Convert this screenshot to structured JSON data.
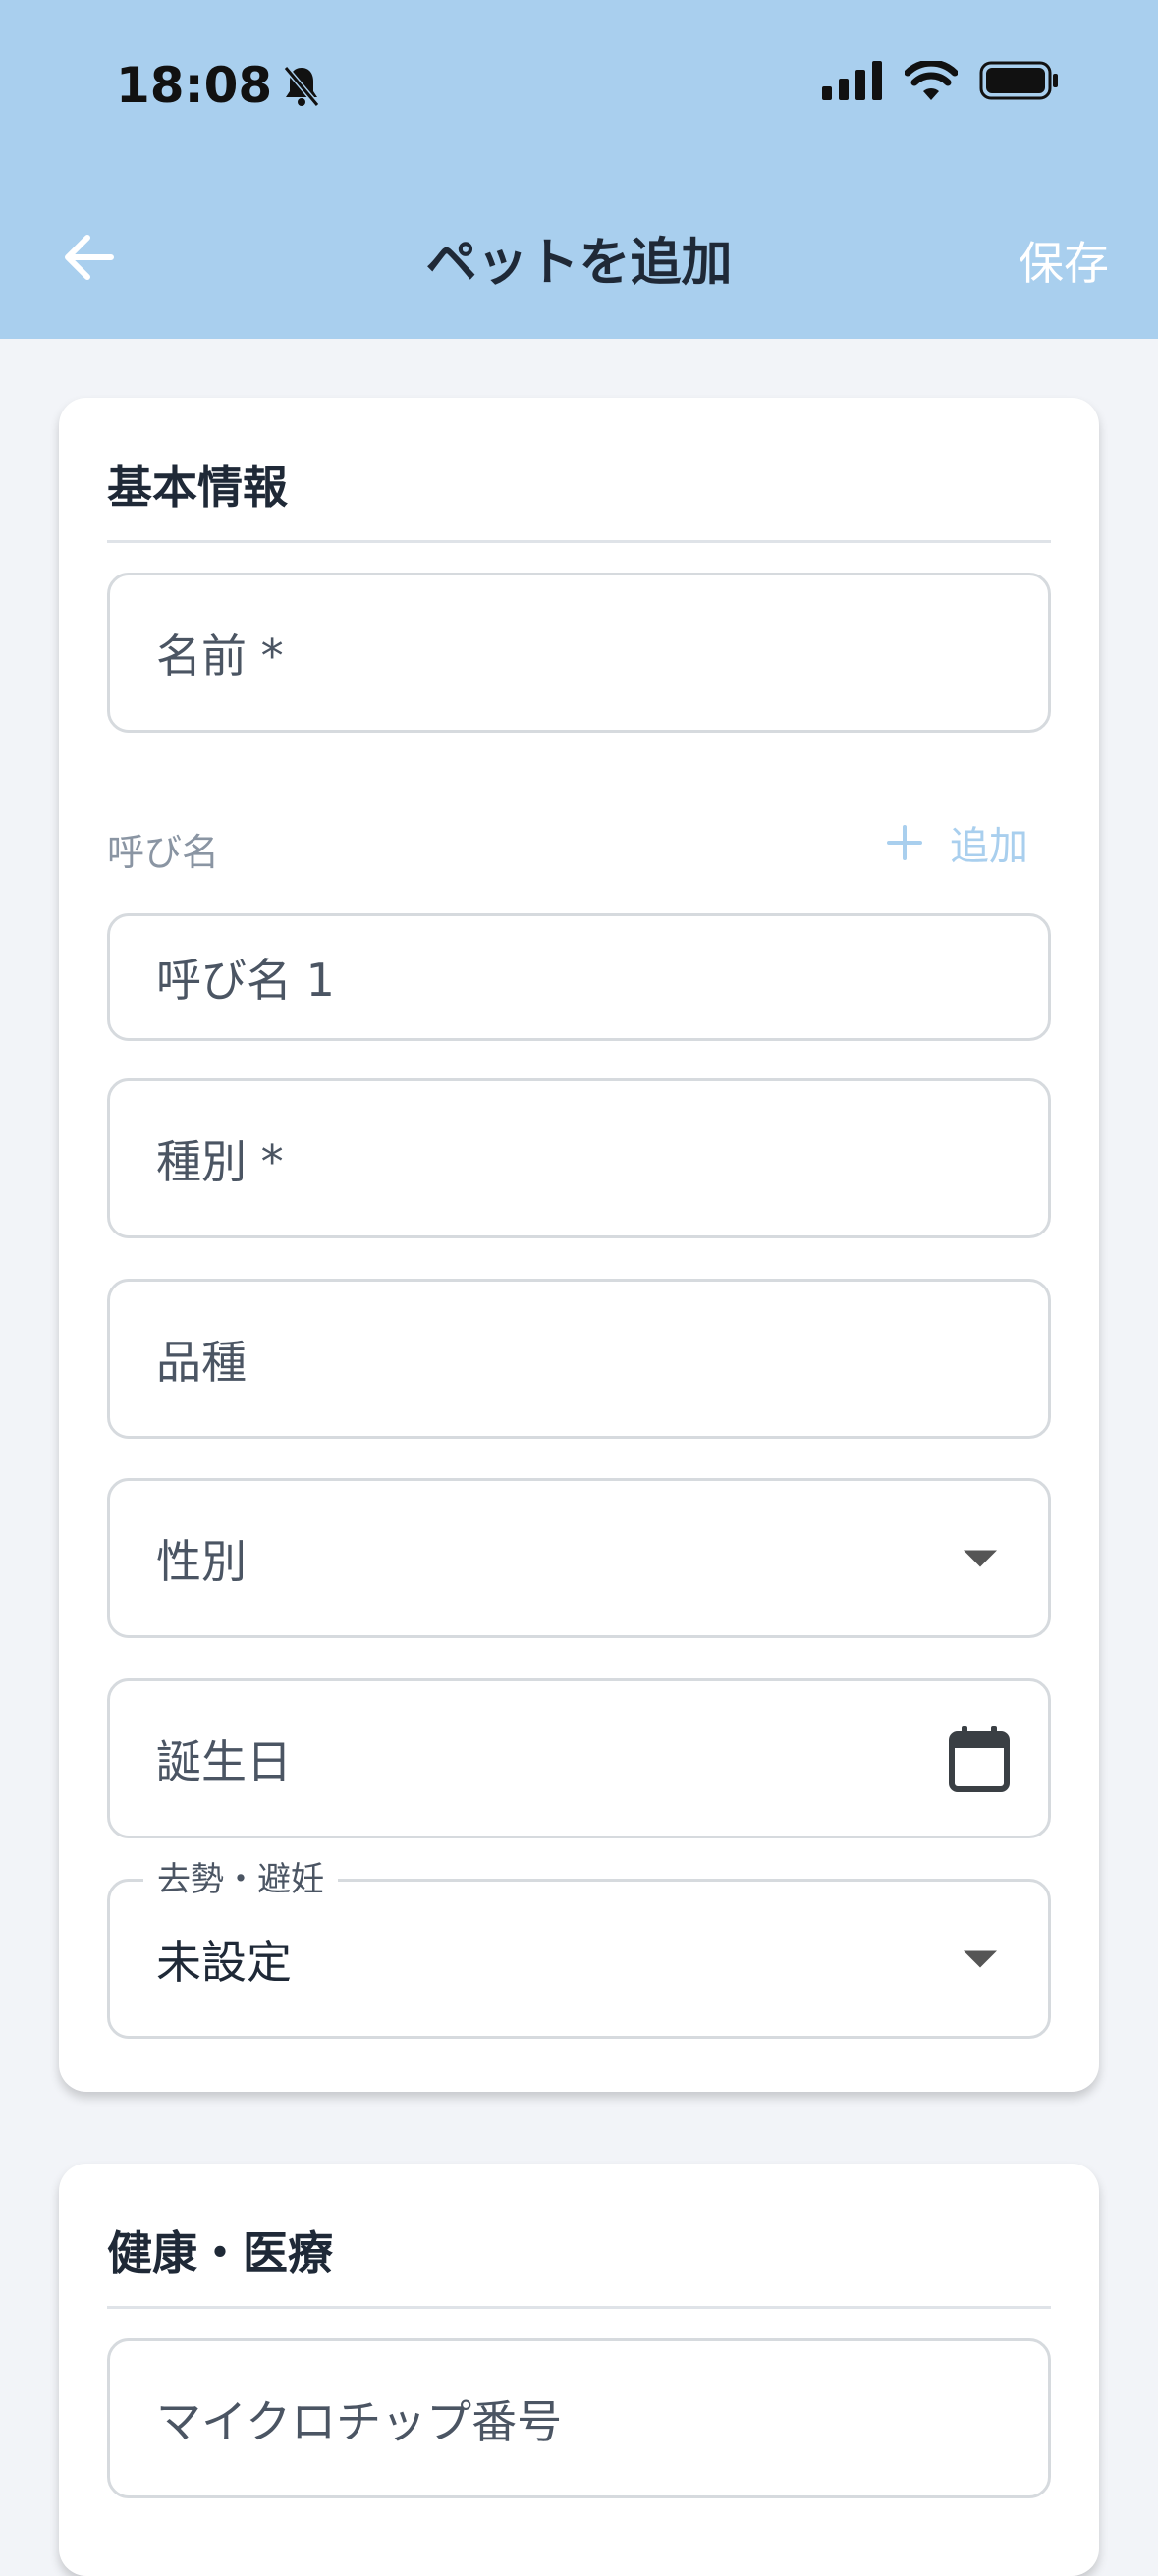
{
  "status_bar": {
    "time": "18:08"
  },
  "header": {
    "title": "ペットを追加",
    "save_label": "保存"
  },
  "basic_info": {
    "title": "基本情報",
    "name_placeholder": "名前 *",
    "nickname_label": "呼び名",
    "nickname_add_label": "追加",
    "nickname_placeholder": "呼び名 1",
    "species_placeholder": "種別 *",
    "breed_placeholder": "品種",
    "sex_placeholder": "性別",
    "birthday_placeholder": "誕生日",
    "neuter_label": "去勢・避妊",
    "neuter_value": "未設定"
  },
  "health": {
    "title": "健康・医療",
    "microchip_placeholder": "マイクロチップ番号"
  },
  "colors": {
    "header_bg": "#a9cfee",
    "accent": "#a9cfee"
  }
}
